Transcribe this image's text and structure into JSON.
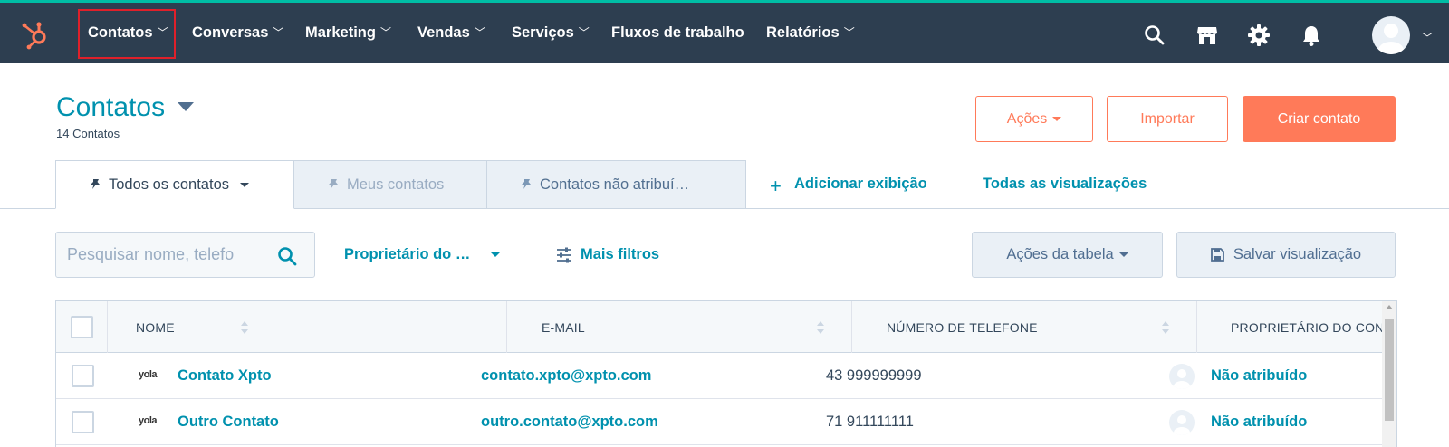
{
  "colors": {
    "nav_bg": "#2d3e50",
    "accent_teal": "#0091ae",
    "primary_orange": "#ff7a59",
    "highlight_red": "#e0202a"
  },
  "topnav": {
    "logo": "hubspot-sprocket-icon",
    "items": [
      {
        "label": "Contatos"
      },
      {
        "label": "Conversas"
      },
      {
        "label": "Marketing"
      },
      {
        "label": "Vendas"
      },
      {
        "label": "Serviços"
      },
      {
        "label": "Fluxos de trabalho"
      },
      {
        "label": "Relatórios"
      }
    ],
    "icons": [
      "search-icon",
      "marketplace-icon",
      "settings-icon",
      "notifications-icon"
    ]
  },
  "header": {
    "title": "Contatos",
    "count": "14 Contatos",
    "actions_label": "Ações",
    "import_label": "Importar",
    "create_label": "Criar contato"
  },
  "tabs": {
    "items": [
      {
        "label": "Todos os contatos"
      },
      {
        "label": "Meus contatos"
      },
      {
        "label": "Contatos não atribuí…"
      }
    ],
    "add_view": "Adicionar exibição",
    "all_views": "Todas as visualizações"
  },
  "filters": {
    "search_placeholder": "Pesquisar nome, telefo",
    "owner_filter": "Proprietário do …",
    "more_filters": "Mais filtros",
    "table_actions": "Ações da tabela",
    "save_view": "Salvar visualização"
  },
  "table": {
    "columns": [
      "NOME",
      "E-MAIL",
      "NÚMERO DE TELEFONE",
      "PROPRIETÁRIO DO CONTATO"
    ],
    "rows": [
      {
        "logo": "yola",
        "name": "Contato Xpto",
        "email": "contato.xpto@xpto.com",
        "phone": "43 999999999",
        "owner": "Não atribuído"
      },
      {
        "logo": "yola",
        "name": "Outro Contato",
        "email": "outro.contato@xpto.com",
        "phone": "71 911111111",
        "owner": "Não atribuído"
      }
    ]
  }
}
